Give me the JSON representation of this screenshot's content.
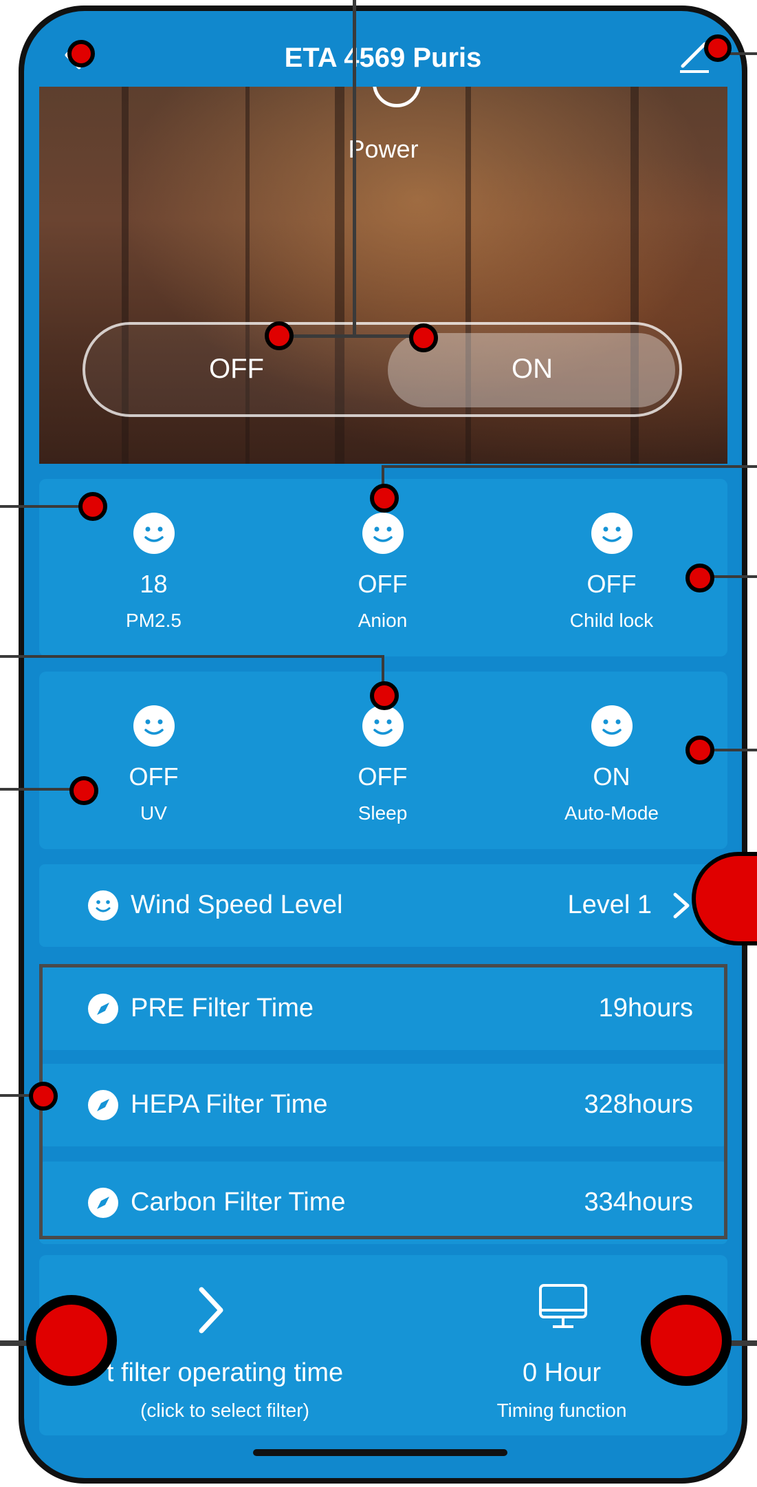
{
  "header": {
    "title": "ETA 4569 Puris"
  },
  "power": {
    "label": "Power",
    "off_label": "OFF",
    "on_label": "ON",
    "state": "ON"
  },
  "status_row_1": [
    {
      "value": "18",
      "label": "PM2.5"
    },
    {
      "value": "OFF",
      "label": "Anion"
    },
    {
      "value": "OFF",
      "label": "Child lock"
    }
  ],
  "status_row_2": [
    {
      "value": "OFF",
      "label": "UV"
    },
    {
      "value": "OFF",
      "label": "Sleep"
    },
    {
      "value": "ON",
      "label": "Auto-Mode"
    }
  ],
  "wind": {
    "label": "Wind Speed Level",
    "value": "Level 1"
  },
  "filters": [
    {
      "label": "PRE Filter Time",
      "value": "19hours"
    },
    {
      "label": "HEPA Filter Time",
      "value": "328hours"
    },
    {
      "label": "Carbon Filter Time",
      "value": "334hours"
    }
  ],
  "reset": {
    "label": "t filter operating time",
    "sublabel": "(click to select filter)"
  },
  "timing": {
    "value": "0 Hour",
    "label": "Timing function"
  },
  "colors": {
    "background": "#1188cd",
    "card": "#1694d6",
    "marker": "#e00000"
  },
  "icons": [
    "back-chevron-icon",
    "edit-pencil-icon",
    "power-icon",
    "smiley-icon",
    "compass-icon",
    "chevron-right-icon",
    "monitor-icon"
  ]
}
